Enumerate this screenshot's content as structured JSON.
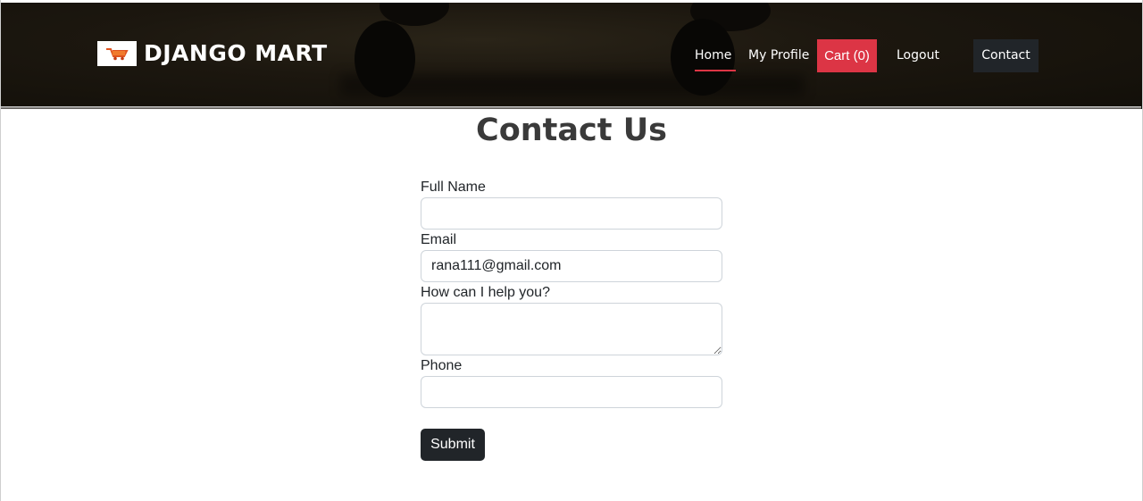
{
  "header": {
    "brand_title": "DJANGO MART",
    "logo_icon": "shopping-cart-icon"
  },
  "nav": {
    "home": "Home",
    "my_profile": "My Profile",
    "cart": "Cart (0)",
    "logout": "Logout",
    "contact": "Contact",
    "active": "Home"
  },
  "main": {
    "title": "Contact Us",
    "form": {
      "full_name_label": "Full Name",
      "full_name_value": "",
      "email_label": "Email",
      "email_value": "rana111@gmail.com",
      "message_label": "How can I help you?",
      "message_value": "",
      "phone_label": "Phone",
      "phone_value": "",
      "submit_label": "Submit"
    }
  },
  "colors": {
    "accent_red": "#dc3545",
    "dark_button": "#212529",
    "header_bg": "#1c170f"
  }
}
